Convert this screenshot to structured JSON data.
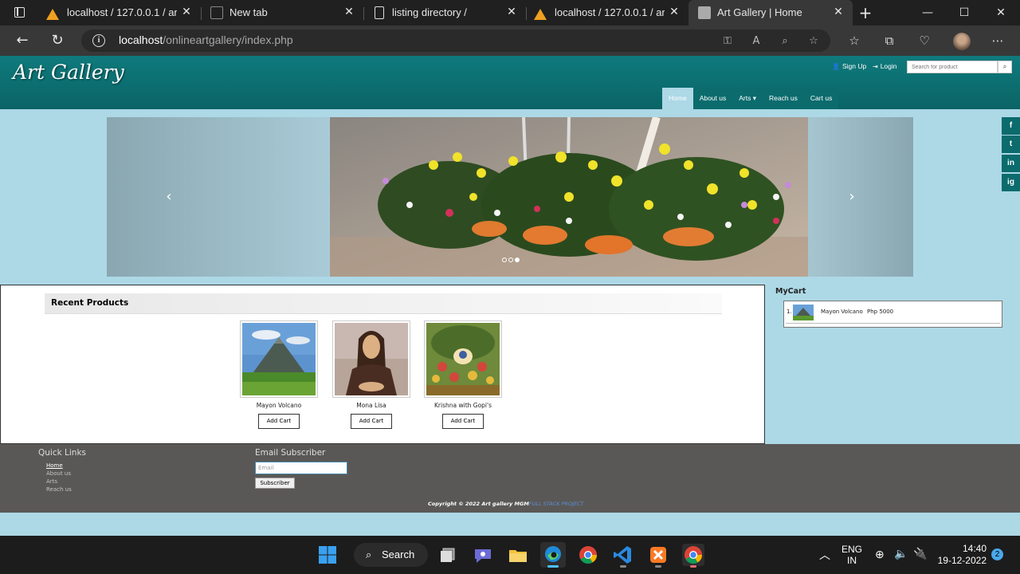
{
  "browser": {
    "tabs": [
      {
        "title": "localhost / 127.0.0.1 / art_",
        "icon": "phpmyadmin-icon"
      },
      {
        "title": "New tab",
        "icon": "blank-page-icon"
      },
      {
        "title": "listing directory /",
        "icon": "document-icon"
      },
      {
        "title": "localhost / 127.0.0.1 / art_",
        "icon": "phpmyadmin-icon"
      },
      {
        "title": "Art Gallery | Home",
        "icon": "gallery-icon",
        "active": true
      }
    ],
    "url_host": "localhost",
    "url_path": "/onlineartgallery/index.php"
  },
  "site": {
    "brand": "Art Gallery",
    "signup": "Sign Up",
    "login": "Login",
    "search_placeholder": "Search for product",
    "menu": [
      "Home",
      "About us",
      "Arts ▾",
      "Reach us",
      "Cart us"
    ],
    "social": [
      "f",
      "t",
      "in",
      "ig"
    ]
  },
  "products": {
    "heading": "Recent Products",
    "items": [
      {
        "name": "Mayon Volcano",
        "button": "Add Cart"
      },
      {
        "name": "Mona Lisa",
        "button": "Add Cart"
      },
      {
        "name": "Krishna with Gopi's",
        "button": "Add Cart"
      }
    ]
  },
  "cart": {
    "title": "MyCart",
    "items": [
      {
        "num": "1.",
        "name": "Mayon Volcano",
        "price": "Php 5000"
      }
    ]
  },
  "footer": {
    "quick_links_title": "Quick Links",
    "quick_links": [
      "Home",
      "About us",
      "Arts",
      "Reach us"
    ],
    "email_title": "Email Subscriber",
    "email_placeholder": "Email",
    "subscribe": "Subscriber",
    "copyright": "Copyright © 2022 Art gallery MGM",
    "copyright_link": "FULL STACK PROJECT"
  },
  "taskbar": {
    "search": "Search",
    "lang1": "ENG",
    "lang2": "IN",
    "time": "14:40",
    "date": "19-12-2022",
    "notif": "2"
  }
}
